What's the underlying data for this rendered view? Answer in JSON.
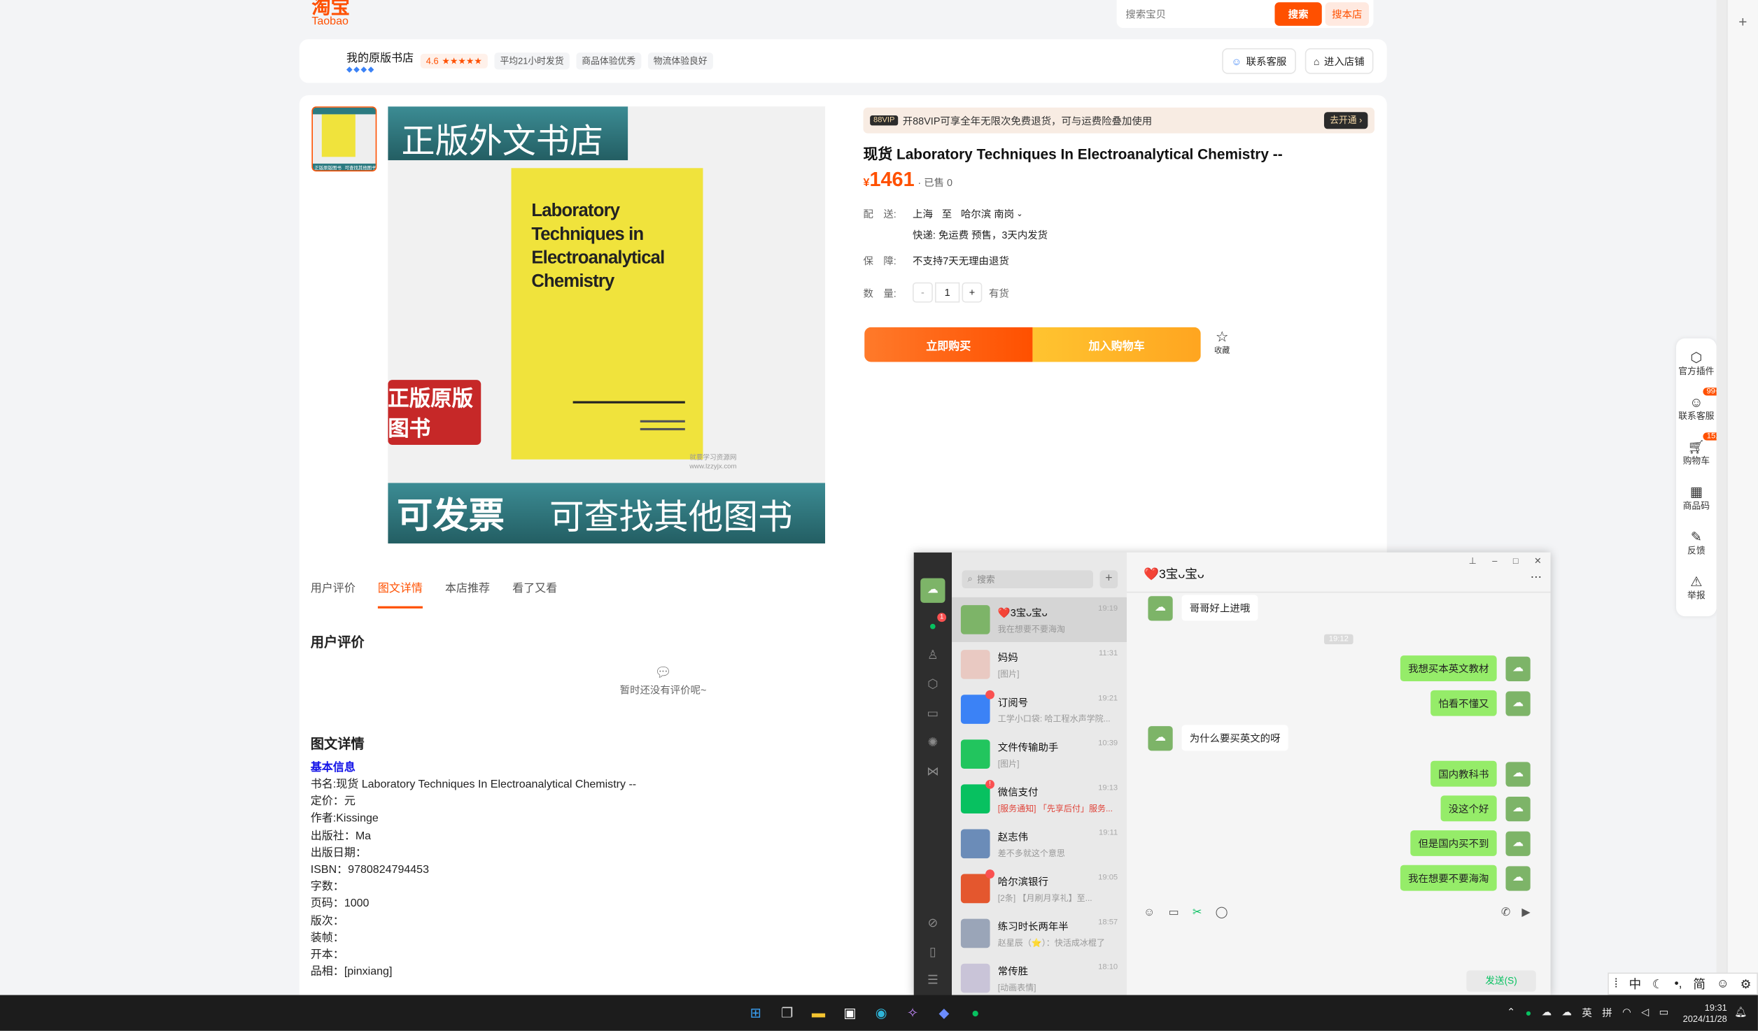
{
  "logo": {
    "cn": "淘宝",
    "en": "Taobao"
  },
  "search": {
    "placeholder": "搜索宝贝",
    "btn_search": "搜索",
    "btn_store": "搜本店"
  },
  "shop": {
    "name": "我的原版书店",
    "rating": "4.6",
    "stars": "★★★★★",
    "badges": [
      "平均21小时发货",
      "商品体验优秀",
      "物流体验良好"
    ],
    "btn_service": "联系客服",
    "btn_enter": "进入店铺"
  },
  "gallery": {
    "thumb_caption_left": "正版原版图书",
    "thumb_caption_right": "可查找其他图书",
    "banner_top": "正版外文书店",
    "book_title": "Laboratory Techniques in Electroanalytical Chemistry",
    "side_stamp": "正版原版图书",
    "banner_bottom_left": "可发票",
    "banner_bottom_right": "可查找其他图书",
    "watermark": "就要学习资源网 www.lzzyjx.com"
  },
  "vip": {
    "tag": "88VIP",
    "text": "开88VIP可享全年无限次免费退货，可与运费险叠加使用",
    "btn": "去开通 ›"
  },
  "product": {
    "title": "现货 Laboratory Techniques In Electroanalytical Chemistry --",
    "currency": "¥",
    "price": "1461",
    "sold": "· 已售 0",
    "ship_label": "配　送:",
    "ship_from": "上海",
    "ship_to_word": "至",
    "ship_dest": "哈尔滨 南岗",
    "ship_detail": "快递: 免运费  预售，3天内发货",
    "guarantee_label": "保　障:",
    "guarantee": "不支持7天无理由退货",
    "qty_label": "数　量:",
    "qty_minus": "-",
    "qty": "1",
    "qty_plus": "+",
    "stock": "有货",
    "buy_now": "立即购买",
    "add_cart": "加入购物车",
    "fav": "收藏"
  },
  "tabs": [
    "用户评价",
    "图文详情",
    "本店推荐",
    "看了又看"
  ],
  "reviews": {
    "title": "用户评价",
    "empty": "暂时还没有评价呢~"
  },
  "details": {
    "title": "图文详情",
    "basic": "基本信息",
    "lines": [
      "书名:现货 Laboratory Techniques In Electroanalytical Chemistry --",
      "定价：元",
      "作者:Kissinge",
      "出版社：Ma",
      "出版日期：",
      "ISBN：9780824794453",
      "字数：",
      "页码：1000",
      "版次：",
      "装帧：",
      "开本：",
      "品相：[pinxiang]"
    ]
  },
  "right_sidebar": [
    {
      "label": "官方插件",
      "icon": "cube-icon",
      "badge": ""
    },
    {
      "label": "联系客服",
      "icon": "service-icon",
      "badge": "99+"
    },
    {
      "label": "购物车",
      "icon": "cart-icon",
      "badge": "151"
    },
    {
      "label": "商品码",
      "icon": "qrcode-icon",
      "badge": ""
    },
    {
      "label": "反馈",
      "icon": "edit-icon",
      "badge": ""
    },
    {
      "label": "举报",
      "icon": "warning-icon",
      "badge": ""
    }
  ],
  "wechat": {
    "search_placeholder": "搜索",
    "chat_title": "❤️3宝ᴗ宝ᴗ",
    "side_badge": "1",
    "chats": [
      {
        "name": "❤️3宝ᴗ宝ᴗ",
        "time": "19:19",
        "msg": "我在想要不要海淘",
        "color": "#7db468",
        "dot": ""
      },
      {
        "name": "妈妈",
        "time": "11:31",
        "msg": "[图片]",
        "color": "#e9c9c2",
        "dot": ""
      },
      {
        "name": "订阅号",
        "time": "19:21",
        "msg": "工学小口袋: 哈工程水声学院...",
        "color": "#3b82f6",
        "dot": " "
      },
      {
        "name": "文件传输助手",
        "time": "10:39",
        "msg": "[图片]",
        "color": "#22c55e",
        "dot": ""
      },
      {
        "name": "微信支付",
        "time": "19:13",
        "msg": "[服务通知] 「先享后付」服务...",
        "color": "#07c160",
        "dot": "!"
      },
      {
        "name": "赵志伟",
        "time": "19:11",
        "msg": "差不多就这个意思",
        "color": "#6b8cb8",
        "dot": ""
      },
      {
        "name": "哈尔滨银行",
        "time": "19:05",
        "msg": "[2条] 【月刷月享礼】至...",
        "color": "#e4572e",
        "dot": " "
      },
      {
        "name": "练习时长两年半",
        "time": "18:57",
        "msg": "赵星辰（⭐）：快活成冰棍了",
        "color": "#9aa5b8",
        "dot": ""
      },
      {
        "name": "常传胜",
        "time": "18:10",
        "msg": "[动画表情]",
        "color": "#c9c4d8",
        "dot": ""
      }
    ],
    "messages": [
      {
        "side": "other",
        "text": "哥哥好上进哦"
      },
      {
        "side": "time",
        "text": "19:12"
      },
      {
        "side": "me",
        "text": "我想买本英文教材"
      },
      {
        "side": "me",
        "text": "怕看不懂又"
      },
      {
        "side": "other",
        "text": "为什么要买英文的呀"
      },
      {
        "side": "me",
        "text": "国内教科书"
      },
      {
        "side": "me",
        "text": "没这个好"
      },
      {
        "side": "me",
        "text": "但是国内买不到"
      },
      {
        "side": "me",
        "text": "我在想要不要海淘"
      }
    ],
    "send": "发送(S)"
  },
  "ime": [
    "中",
    "简"
  ],
  "taskbar": {
    "lang1": "英",
    "lang2": "拼",
    "time": "19:31",
    "date": "2024/11/28"
  }
}
